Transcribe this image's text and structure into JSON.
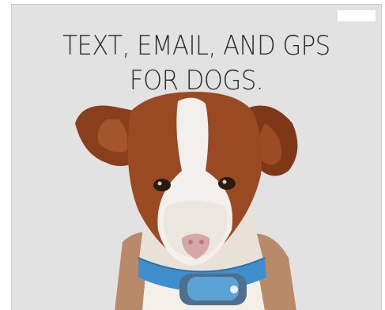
{
  "ad": {
    "headline_line1": "TEXT, EMAIL, AND GPS",
    "headline_line2": "FOR DOGS."
  },
  "colors": {
    "background": "#e2e2e2",
    "text": "#2d2d2d",
    "collar": "#3f8fcf"
  }
}
